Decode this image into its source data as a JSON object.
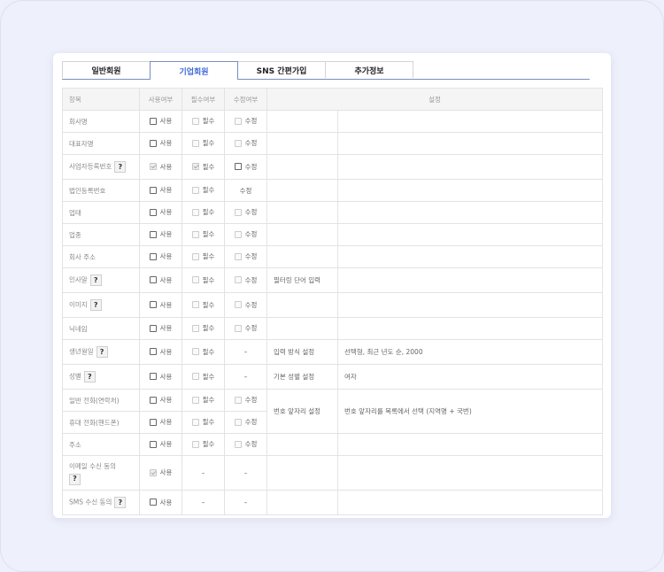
{
  "tabs": [
    {
      "label": "일반회원",
      "active": false
    },
    {
      "label": "기업회원",
      "active": true
    },
    {
      "label": "SNS 간편가입",
      "active": false
    },
    {
      "label": "추가정보",
      "active": false
    }
  ],
  "header": {
    "item": "항목",
    "use": "사용여부",
    "required": "필수여부",
    "editable": "수정여부",
    "settings": "설정"
  },
  "option_labels": {
    "use": "사용",
    "required": "필수",
    "edit": "수정",
    "dash": "–"
  },
  "rows": [
    {
      "label": "회사명"
    },
    {
      "label": "대표자명"
    },
    {
      "label": "사업자등록번호"
    },
    {
      "label": "법인등록번호",
      "edit_plain": "수정"
    },
    {
      "label": "업태"
    },
    {
      "label": "업종"
    },
    {
      "label": "회사 주소"
    },
    {
      "label": "인사말",
      "setting_key": "필터링 단어 입력"
    },
    {
      "label": "이미지"
    },
    {
      "label": "닉네임"
    },
    {
      "label": "생년월일",
      "setting_key": "입력 방식 설정",
      "setting_value": "선택형, 최근 년도 순, 2000"
    },
    {
      "label": "성별",
      "setting_key": "기본 성별 설정",
      "setting_value": "여자"
    },
    {
      "label": "일반 전화(연락처)",
      "setting_key": "번호 앞자리 설정",
      "setting_value": "번호 앞자리를 목록에서 선택 (지역명 + 국번)"
    },
    {
      "label": "휴대 전화(핸드폰)"
    },
    {
      "label": "주소"
    },
    {
      "label": "이메일 수신 동의"
    },
    {
      "label": "SMS 수신 동의"
    }
  ]
}
